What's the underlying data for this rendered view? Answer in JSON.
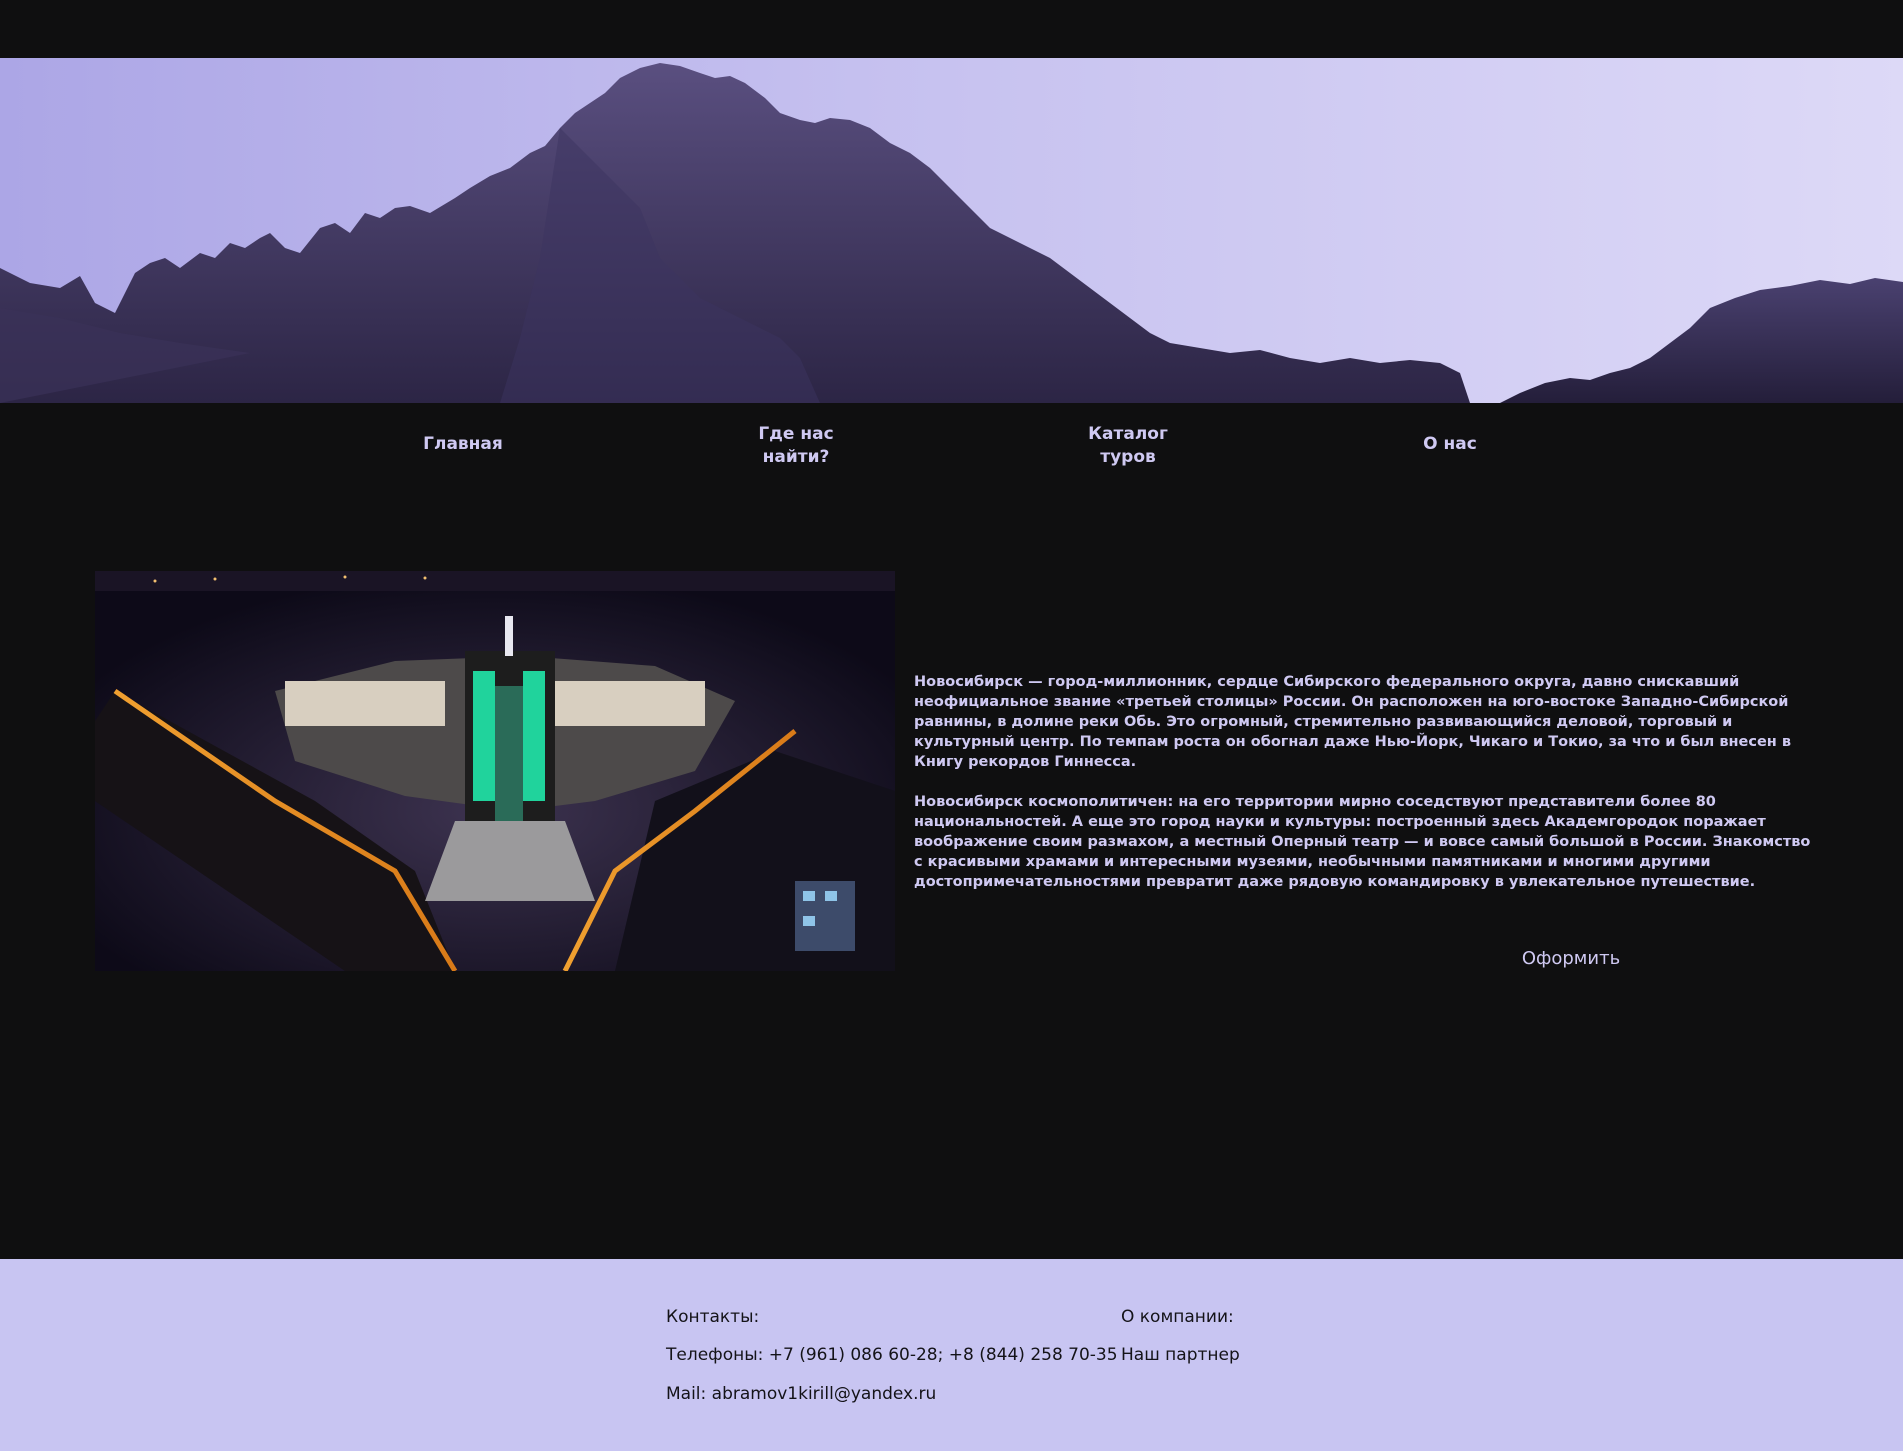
{
  "nav": {
    "items": [
      {
        "label": "Главная"
      },
      {
        "label": "Где нас\nнайти?"
      },
      {
        "label": "Каталог\nтуров"
      },
      {
        "label": "О нас"
      }
    ]
  },
  "content": {
    "paragraphs": [
      "Новосибирск — город-миллионник, сердце Сибирского федерального округа, давно снискавший неофициальное звание «третьей столицы» России. Он расположен на юго-востоке Западно-Сибирской равнины, в долине реки Обь. Это огромный, стремительно развивающийся деловой, торговый и культурный центр. По темпам роста он обогнал даже Нью-Йорк, Чикаго и Токио, за что и был внесен в Книгу рекордов Гиннесса.",
      "Новосибирск космополитичен: на его территории мирно соседствуют представители более 80 национальностей. А еще это город науки и культуры: построенный здесь Академгородок поражает воображение своим размахом, а местный Оперный театр — и вовсе самый большой в России. Знакомство с красивыми храмами и интересными музеями, необычными памятниками и многими другими достопримечательностями превратит даже рядовую командировку в увлекательное путешествие."
    ],
    "order_button": "Оформить"
  },
  "footer": {
    "contacts_title": "Контакты:",
    "phones": "Телефоны: +7 (961) 086 60-28; +8 (844) 258 70-35",
    "mail": "Mail: abramov1kirill@yandex.ru",
    "company_title": "О компании:",
    "partner": "Наш партнер"
  },
  "colors": {
    "background": "#0f0f10",
    "accent_lavender": "#c8c5f2",
    "text_light": "#cfc9f2",
    "footer_text": "#141318"
  }
}
